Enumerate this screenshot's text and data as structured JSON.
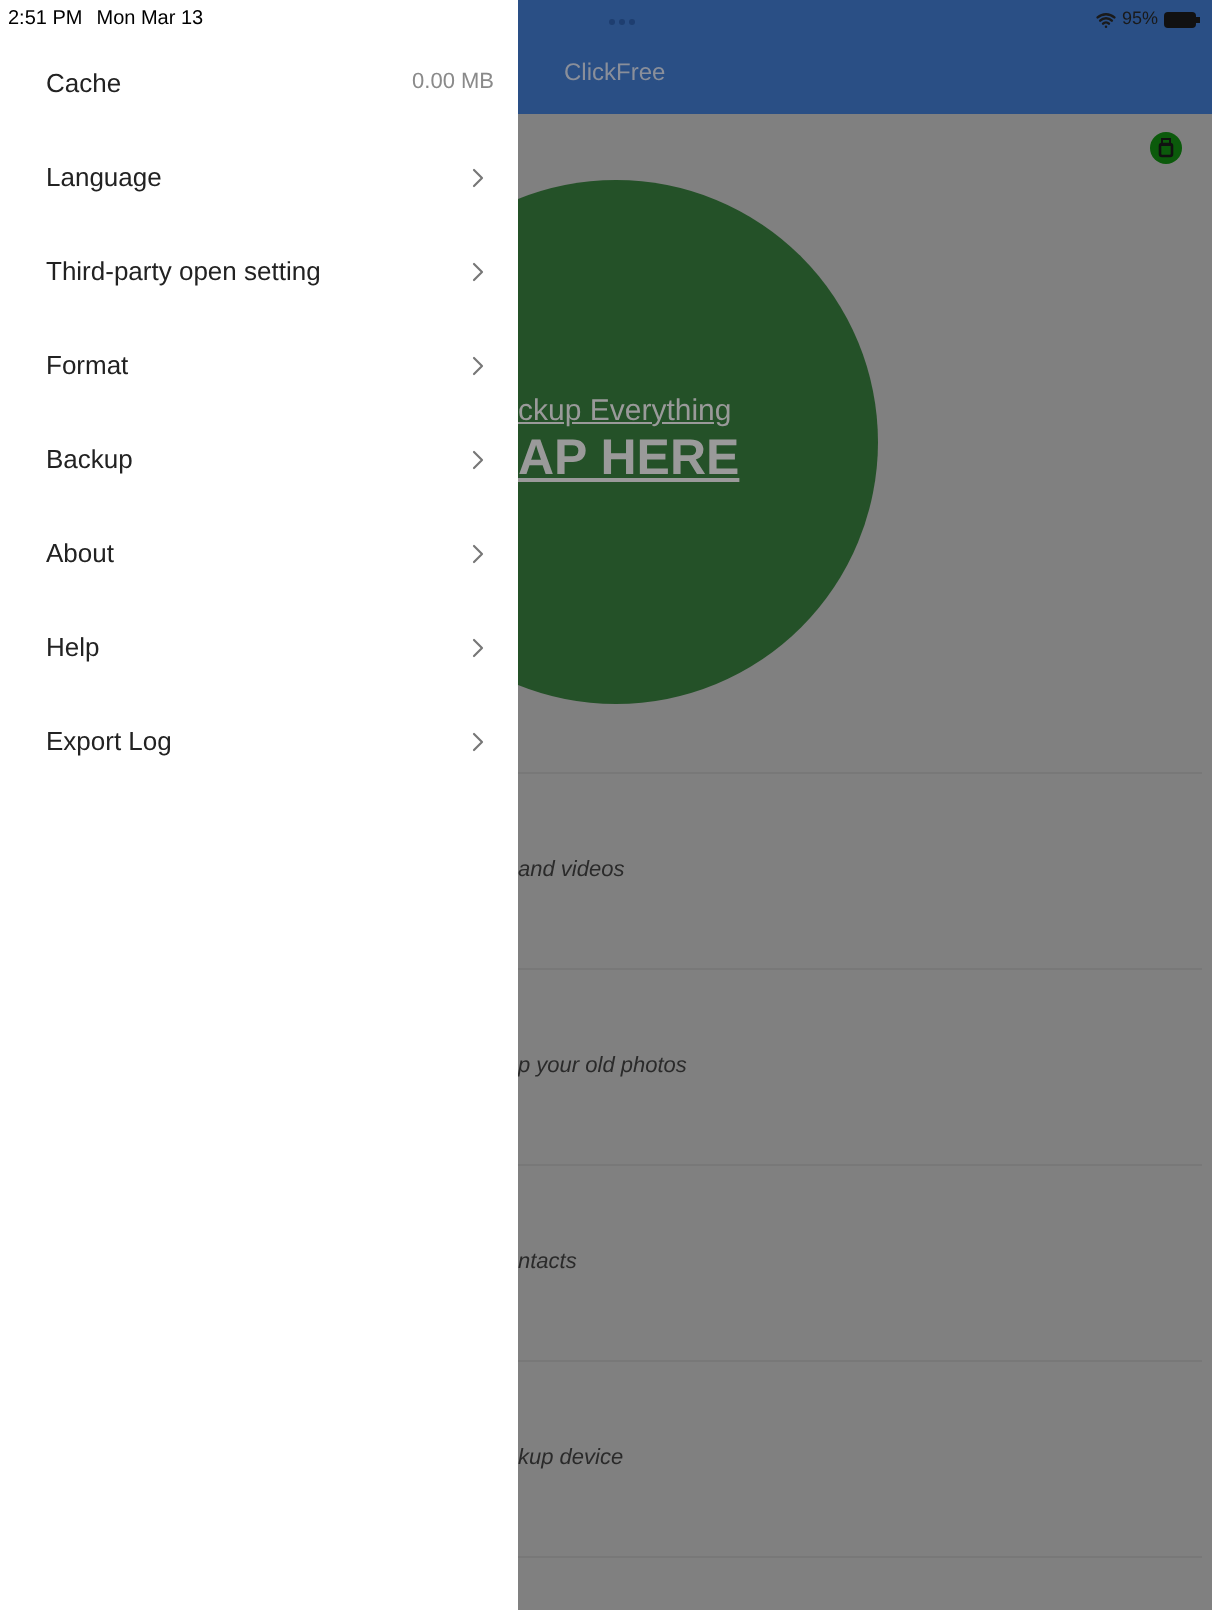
{
  "status_bar": {
    "time": "2:51 PM",
    "date": "Mon Mar 13",
    "battery": "95%"
  },
  "drawer": {
    "items": [
      {
        "kind": "value",
        "label": "Cache",
        "value": "0.00 MB"
      },
      {
        "kind": "link",
        "label": "Language"
      },
      {
        "kind": "link",
        "label": "Third-party open setting"
      },
      {
        "kind": "link",
        "label": "Format"
      },
      {
        "kind": "link",
        "label": "Backup"
      },
      {
        "kind": "link",
        "label": "About"
      },
      {
        "kind": "link",
        "label": "Help"
      },
      {
        "kind": "link",
        "label": "Export Log"
      }
    ]
  },
  "app": {
    "title": "ClickFree",
    "backup_button": {
      "subtitle": "ckup Everything",
      "label": "AP HERE"
    },
    "rows": [
      "and videos",
      "p your old photos",
      "ntacts",
      "kup device"
    ]
  }
}
